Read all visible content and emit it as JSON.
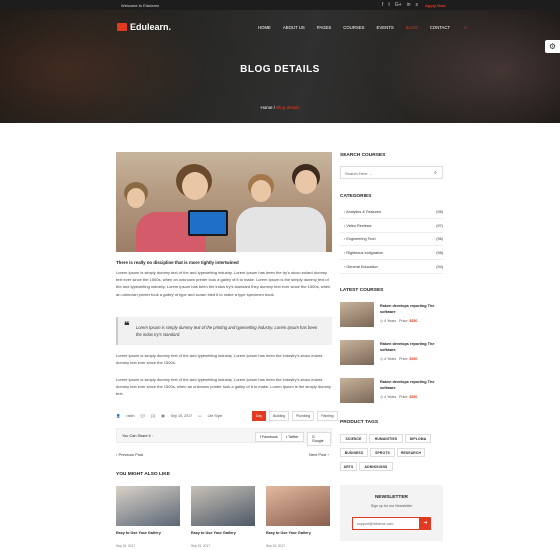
{
  "topbar": {
    "welcome": "Welcome to Edulearn",
    "apply": "Apply Now",
    "social_icons": [
      "facebook-icon",
      "twitter-icon",
      "google-plus-icon",
      "linkedin-icon",
      "skype-icon"
    ],
    "social_glyphs": [
      "f",
      "t",
      "G+",
      "in",
      "s"
    ]
  },
  "header": {
    "logo": "Edulearn.",
    "nav": [
      "HOME",
      "ABOUT US",
      "PAGES",
      "COURSES",
      "EVENTS",
      "BLOG",
      "CONTACT"
    ],
    "active_nav": "BLOG",
    "search_glyph": "⌕"
  },
  "hero": {
    "title": "BLOG DETAILS",
    "breadcrumb_home": "Home",
    "breadcrumb_sep": "/",
    "breadcrumb_current": "Blog details"
  },
  "settings": {
    "glyph": "⚙"
  },
  "post": {
    "subtitle": "There is really no discipline that is more tightly intertwined",
    "p1": "Lorem Ipsum is simply dummy text of the and typesetting industry. Lorem Ipsum has been the try's stuso eolard dummy text ever since the 1500s, when an unknown printer took a galley of it to make. Lorem Ipsum is the simply dummy text of the and typesetting industry. Lorem Ipsum has been the indus try's standard they dummy text ever since the 1500s, when an unknown printer took a galley of type and scram bled it to make a type specimen book.",
    "quote": "Lorem Ipsum is simply dummy text of the printing and typesetting industry. Lorem Ipsum has been the indus try's standard.",
    "quote_mark": "❝",
    "p2": "Lorem Ipsum is simply dummy text of the and typesetting industry. Lorem Ipsum has been the industry's stuso eolard dummy text ever since the 1500s.",
    "p3": "Lorem Ipsum is simply dummy text of the and typesetting industry. Lorem Ipsum has been the industry's stuso eolard dummy text ever since the 1500s, when an unknown printer took a galley of it to make. Lorem Ipsum is the simply dummy text.",
    "meta": {
      "author": "rabin",
      "comments": "(1)",
      "date": "Sep 15, 2017",
      "category": "Life Style"
    },
    "tags": [
      "Day",
      "Building",
      "Plumbing",
      "Painting"
    ],
    "share_label": "You Can Share it :",
    "share": [
      "Facebook",
      "Twitter",
      "Google"
    ],
    "prev": "‹ Previous Post",
    "next": "Next Post ›"
  },
  "sidebar": {
    "search_title": "SEARCH COURSES",
    "search_placeholder": "Search Here ...",
    "search_glyph": "⌕",
    "categories_title": "CATEGORIES",
    "categories": [
      {
        "name": "Analytics & Features",
        "count": "(95)"
      },
      {
        "name": "Video Reviews",
        "count": "(97)"
      },
      {
        "name": "Engineering Tech",
        "count": "(96)"
      },
      {
        "name": "Righteous Indignation",
        "count": "(98)"
      },
      {
        "name": "General Education",
        "count": "(94)"
      }
    ],
    "latest_title": "LATEST COURSES",
    "courses": [
      {
        "title": "Raken develops reporting The software",
        "years": "4 Years",
        "price_label": "Price:",
        "price": "$350"
      },
      {
        "title": "Raken develops reporting The software",
        "years": "4 Years",
        "price_label": "Price:",
        "price": "$350"
      },
      {
        "title": "Raken develops reporting The software",
        "years": "4 Years",
        "price_label": "Price:",
        "price": "$350"
      }
    ],
    "tags_title": "PRODUCT TAGS",
    "product_tags": [
      "SCIENCE",
      "HUMANITIES",
      "DIPLOMA",
      "BUSINESS",
      "SPROTS",
      "RESEARCH",
      "ARTS",
      "ADMISSIONS"
    ],
    "newsletter": {
      "title": "NEWSLETTER",
      "subtitle": "Sign up for our Newsletter",
      "placeholder": "support@rstheme.com",
      "button_glyph": "➜"
    }
  },
  "related": {
    "title": "YOU MIGHT ALSO LIKE",
    "items": [
      {
        "title": "Easy to Use Your Gallery",
        "date": "Sep 15, 2017"
      },
      {
        "title": "Easy to Use Your Gallery",
        "date": "Sep 15, 2017"
      },
      {
        "title": "Easy to Use Your Gallery",
        "date": "Sep 15, 2017"
      }
    ]
  },
  "colors": {
    "accent": "#e23a20",
    "dark": "#1d1d1d"
  }
}
